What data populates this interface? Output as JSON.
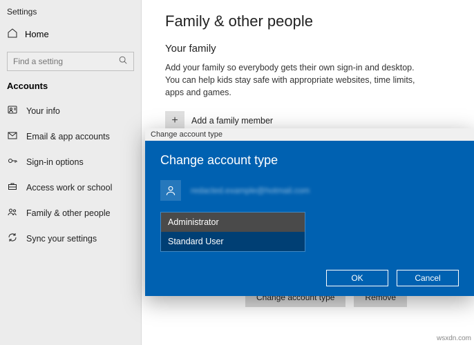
{
  "app_title": "Settings",
  "home_label": "Home",
  "search": {
    "placeholder": "Find a setting"
  },
  "section_label": "Accounts",
  "nav": [
    {
      "label": "Your info"
    },
    {
      "label": "Email & app accounts"
    },
    {
      "label": "Sign-in options"
    },
    {
      "label": "Access work or school"
    },
    {
      "label": "Family & other people"
    },
    {
      "label": "Sync your settings"
    }
  ],
  "page": {
    "title": "Family & other people",
    "family_heading": "Your family",
    "family_body": "Add your family so everybody gets their own sign-in and desktop. You can help kids stay safe with appropriate websites, time limits, apps and games.",
    "add_family": "Add a family member"
  },
  "bottom_buttons": {
    "change_type": "Change account type",
    "remove": "Remove"
  },
  "dialog": {
    "titlebar": "Change account type",
    "heading": "Change account type",
    "email": "redacted.example@hotmail.com",
    "options": {
      "admin": "Administrator",
      "standard": "Standard User"
    },
    "ok": "OK",
    "cancel": "Cancel"
  },
  "watermark": "wsxdn.com"
}
